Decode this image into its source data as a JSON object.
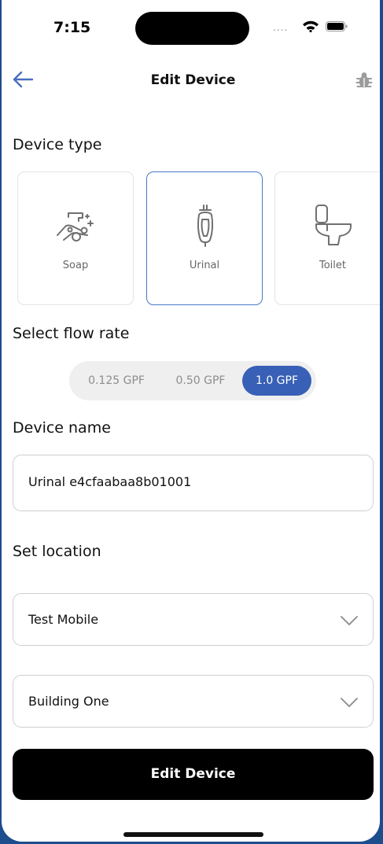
{
  "status_bar": {
    "time": "7:15",
    "signal": "...."
  },
  "header": {
    "title": "Edit Device"
  },
  "device_type": {
    "label": "Device type",
    "options": [
      {
        "label": "Soap",
        "icon": "soap-hands-icon",
        "selected": false
      },
      {
        "label": "Urinal",
        "icon": "urinal-icon",
        "selected": true
      },
      {
        "label": "Toilet",
        "icon": "toilet-icon",
        "selected": false
      }
    ]
  },
  "flow_rate": {
    "label": "Select flow rate",
    "options": [
      "0.125 GPF",
      "0.50 GPF",
      "1.0 GPF"
    ],
    "selected": "1.0 GPF"
  },
  "device_name": {
    "label": "Device name",
    "value": "Urinal e4cfaabaa8b01001"
  },
  "location": {
    "label": "Set location",
    "site": "Test Mobile",
    "building": "Building One"
  },
  "actions": {
    "submit_label": "Edit Device"
  },
  "colors": {
    "accent": "#3860b6",
    "card_selected_border": "#4a78c8",
    "primary_button": "#000000"
  }
}
